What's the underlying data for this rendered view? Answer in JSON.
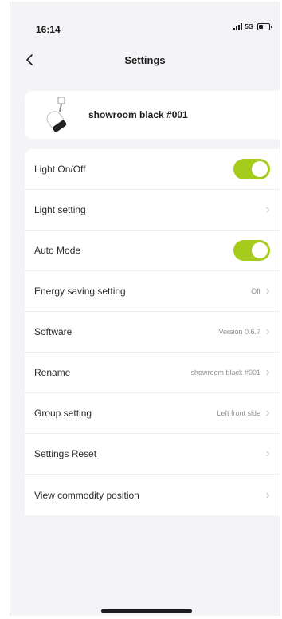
{
  "status_bar": {
    "time": "16:14",
    "network": "5G"
  },
  "nav": {
    "title": "Settings",
    "back_icon": "chevron-left-icon"
  },
  "device": {
    "name": "showroom black #001",
    "icon": "track-spotlight-icon"
  },
  "colors": {
    "toggle_on": "#a6cc1b",
    "background": "#f4f4f6"
  },
  "settings": [
    {
      "label": "Light On/Off",
      "control": "toggle",
      "on": true
    },
    {
      "label": "Light setting",
      "control": "chevron",
      "value": ""
    },
    {
      "label": "Auto Mode",
      "control": "toggle",
      "on": true
    },
    {
      "label": "Energy saving setting",
      "control": "chevron",
      "value": "Off"
    },
    {
      "label": "Software",
      "control": "chevron",
      "value": "Version 0.6.7"
    },
    {
      "label": "Rename",
      "control": "chevron",
      "value": "showroom black #001"
    },
    {
      "label": "Group setting",
      "control": "chevron",
      "value": "Left front side"
    },
    {
      "label": "Settings Reset",
      "control": "chevron",
      "value": ""
    },
    {
      "label": "View commodity position",
      "control": "chevron",
      "value": ""
    }
  ]
}
